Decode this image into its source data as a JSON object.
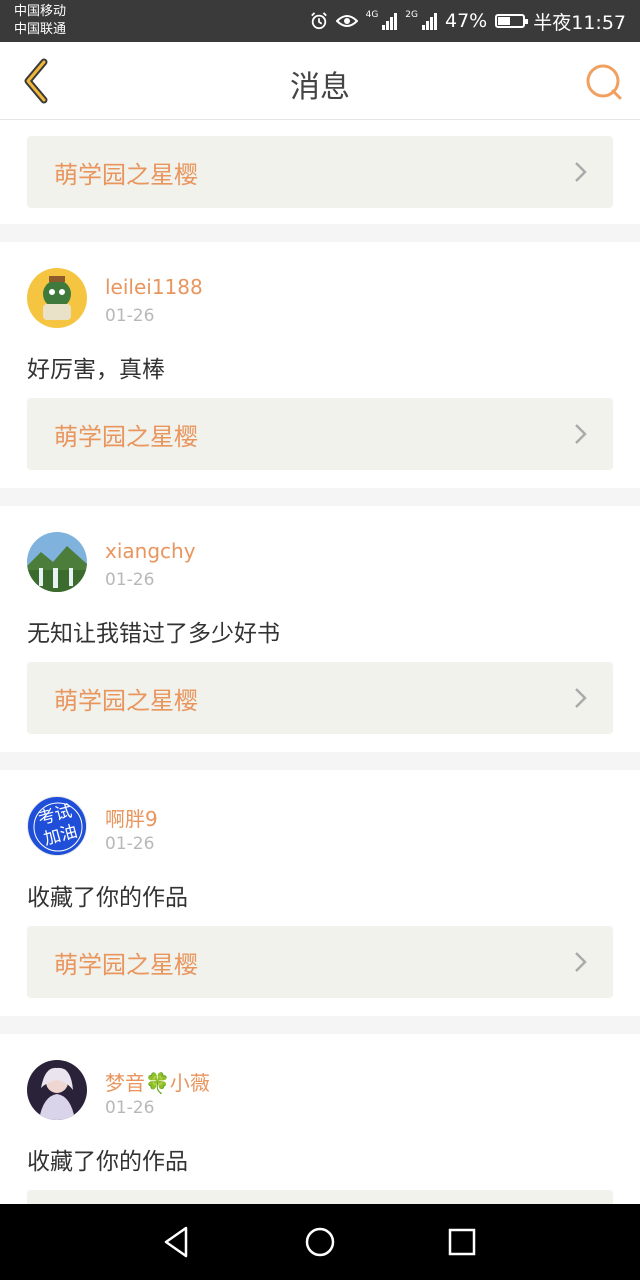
{
  "status_bar": {
    "carrier1": "中国移动",
    "carrier2": "中国联通",
    "net1": "4G",
    "net2": "2G",
    "battery": "47%",
    "battery_level": 0.47,
    "time": "半夜11:57",
    "icons": [
      "alarm-icon",
      "eye-icon",
      "signal-icon",
      "battery-icon"
    ]
  },
  "header": {
    "title": "消息",
    "back_icon": "chevron-left-icon",
    "search_icon": "search-icon"
  },
  "colors": {
    "accent": "#e8955e",
    "back": "#f0b63a",
    "link_bg": "#f2f2ec"
  },
  "messages": [
    {
      "username": "",
      "date": "",
      "comment": "",
      "work_title": "萌学园之星樱"
    },
    {
      "username": "leilei1188",
      "date": "01-26",
      "comment": "好厉害，真棒",
      "work_title": "萌学园之星樱",
      "avatar": "avatar-cartoon"
    },
    {
      "username": "xiangchy",
      "date": "01-26",
      "comment": "无知让我错过了多少好书",
      "work_title": "萌学园之星樱",
      "avatar": "avatar-waterfall"
    },
    {
      "username": "啊胖9",
      "date": "01-26",
      "comment": "收藏了你的作品",
      "work_title": "萌学园之星樱",
      "avatar": "avatar-badge",
      "avatar_text": "考试加油"
    },
    {
      "username": "梦音🍀小薇",
      "date": "01-26",
      "comment": "收藏了你的作品",
      "work_title": "",
      "avatar": "avatar-girl"
    }
  ],
  "nav": [
    "back-nav-icon",
    "home-nav-icon",
    "recents-nav-icon"
  ]
}
